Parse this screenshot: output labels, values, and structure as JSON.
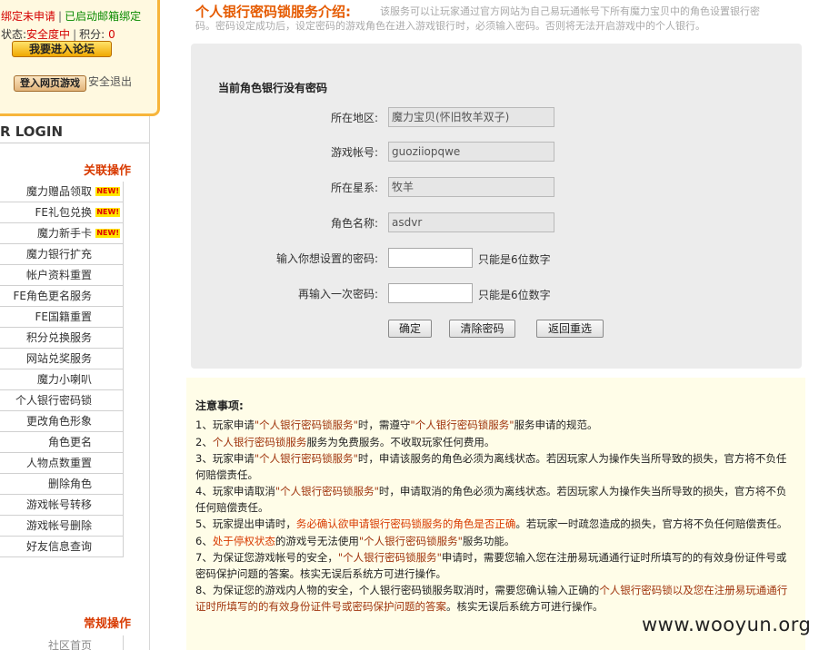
{
  "userbox": {
    "status_unbound": "绑定未申请",
    "status_mail": "已启动邮箱绑定",
    "status_label": "状态:",
    "status_value": "安全度中",
    "points_label": "积分:",
    "points_value": "0",
    "forum_button": "我要进入论坛",
    "web_game_button": "登入网页游戏",
    "logout": "安全退出"
  },
  "login_title": "R LOGIN",
  "nav": {
    "section_related": "关联操作",
    "section_common": "常规操作",
    "new_badge": "NEW!",
    "items": [
      {
        "label": "魔力赠品领取",
        "new": true
      },
      {
        "label": "FE礼包兑换",
        "new": true
      },
      {
        "label": "魔力新手卡",
        "new": true
      },
      {
        "label": "魔力银行扩充",
        "new": false
      },
      {
        "label": "帐户资料重置",
        "new": false
      },
      {
        "label": "FE角色更名服务",
        "new": false
      },
      {
        "label": "FE国籍重置",
        "new": false
      },
      {
        "label": "积分兑换服务",
        "new": false
      },
      {
        "label": "网站兑奖服务",
        "new": false
      },
      {
        "label": "魔力小喇叭",
        "new": false
      },
      {
        "label": "个人银行密码锁",
        "new": false
      },
      {
        "label": "更改角色形象",
        "new": false
      },
      {
        "label": "角色更名",
        "new": false
      },
      {
        "label": "人物点数重置",
        "new": false
      },
      {
        "label": "删除角色",
        "new": false
      },
      {
        "label": "游戏帐号转移",
        "new": false
      },
      {
        "label": "游戏帐号删除",
        "new": false
      },
      {
        "label": "好友信息查询",
        "new": false
      }
    ],
    "common_first": "社区首页"
  },
  "main": {
    "title": "个人银行密码锁服务介绍:",
    "desc_line1": "该服务可以让玩家通过官方网站为自己易玩通帐号下所有魔力宝贝中的角色设置银行密",
    "desc_line2": "码。密码设定成功后，设定密码的游戏角色在进入游戏银行时，必须输入密码。否则将无法开启游戏中的个人银行。"
  },
  "form": {
    "heading": "当前角色银行没有密码",
    "region_label": "所在地区:",
    "region_value": "魔力宝贝(怀旧牧羊双子)",
    "account_label": "游戏帐号:",
    "account_value": "guoziiopqwe",
    "star_label": "所在星系:",
    "star_value": "牧羊",
    "role_label": "角色名称:",
    "role_value": "asdvr",
    "pwd_label": "输入你想设置的密码:",
    "pwd_hint": "只能是6位数字",
    "pwd2_label": "再输入一次密码:",
    "pwd2_hint": "只能是6位数字",
    "confirm_button": "确定",
    "clear_button": "清除密码",
    "back_button": "返回重选"
  },
  "notes": {
    "title": "注意事项:",
    "n1_a": "1、玩家申请",
    "n1_b": "\"个人银行密码锁服务\"",
    "n1_c": "时，需遵守",
    "n1_d": "\"个人银行密码锁服务\"",
    "n1_e": "服务申请的规范。",
    "n2_a": "2、",
    "n2_b": "个人银行密码锁服务",
    "n2_c": "服务为免费服务。不收取玩家任何费用。",
    "n3_a": "3、玩家申请",
    "n3_b": "\"个人银行密码锁服务\"",
    "n3_c": "时，申请该服务的角色必须为离线状态。若因玩家人为操作失当所导致的损失，官方将不负任何赔偿责任。",
    "n4_a": "4、玩家申请取消",
    "n4_b": "\"个人银行密码锁服务\"",
    "n4_c": "时，申请取消的角色必须为离线状态。若因玩家人为操作失当所导致的损失，官方将不负任何赔偿责任。",
    "n5_a": "5、玩家提出申请时，",
    "n5_b": "务必确认欲申请银行密码锁服务的角色是否正确",
    "n5_c": "。若玩家一时疏忽造成的损失，官方将不负任何赔偿责任。",
    "n6_a": "6、",
    "n6_b": "处于停权状态",
    "n6_c": "的游戏号无法使用",
    "n6_d": "\"个人银行密码锁服务\"",
    "n6_e": "服务功能。",
    "n7_a": "7、为保证您游戏帐号的安全，",
    "n7_b": "\"个人银行密码锁服务\"",
    "n7_c": "申请时，需要您输入您在注册易玩通通行证时所填写的的有效身份证件号或密码保护问题的答案。核实无误后系统方可进行操作。",
    "n8_a": "8、为保证您的游戏内人物的安全，个人银行密码锁服务取消时，需要您确认输入正确的",
    "n8_b": "个人银行密码锁以及您在注册易玩通通行证时所填写的的有效身份证件号或密码保护问题的答案",
    "n8_c": "。核实无误后系统方可进行操作。"
  },
  "watermark": "www.wooyun.org"
}
